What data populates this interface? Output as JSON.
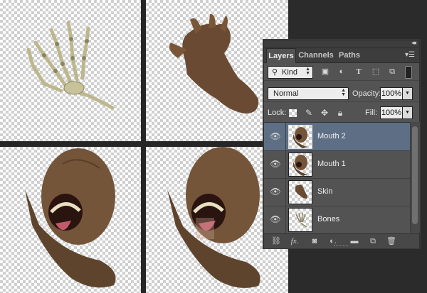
{
  "panel": {
    "tabs": [
      {
        "label": "Layers",
        "active": true
      },
      {
        "label": "Channels",
        "active": false
      },
      {
        "label": "Paths",
        "active": false
      }
    ],
    "filter": {
      "kind_label": "Kind",
      "icons": [
        "image-filter-icon",
        "adjustment-filter-icon",
        "type-filter-icon",
        "shape-filter-icon",
        "smart-object-filter-icon",
        "filter-toggle-icon"
      ]
    },
    "blend_mode": "Normal",
    "opacity_label": "Opacity:",
    "opacity_value": "100%",
    "lock_label": "Lock:",
    "lock_icons": [
      "lock-transparent-pixels-icon",
      "lock-image-pixels-icon",
      "lock-position-icon",
      "lock-all-icon"
    ],
    "fill_label": "Fill:",
    "fill_value": "100%",
    "layers": [
      {
        "name": "Mouth 2",
        "selected": true,
        "visible": true
      },
      {
        "name": "Mouth 1",
        "selected": false,
        "visible": true
      },
      {
        "name": "Skin",
        "selected": false,
        "visible": true
      },
      {
        "name": "Bones",
        "selected": false,
        "visible": true
      }
    ],
    "bottom_icons": [
      "link-layers-icon",
      "fx-icon",
      "add-mask-icon",
      "adjustment-layer-icon",
      "new-group-icon",
      "new-layer-icon",
      "delete-layer-icon"
    ]
  },
  "colors": {
    "panel_bg": "#535353",
    "selected_layer": "#5e6f85",
    "skin": "#6b4a33",
    "bone": "#c8c29a"
  }
}
